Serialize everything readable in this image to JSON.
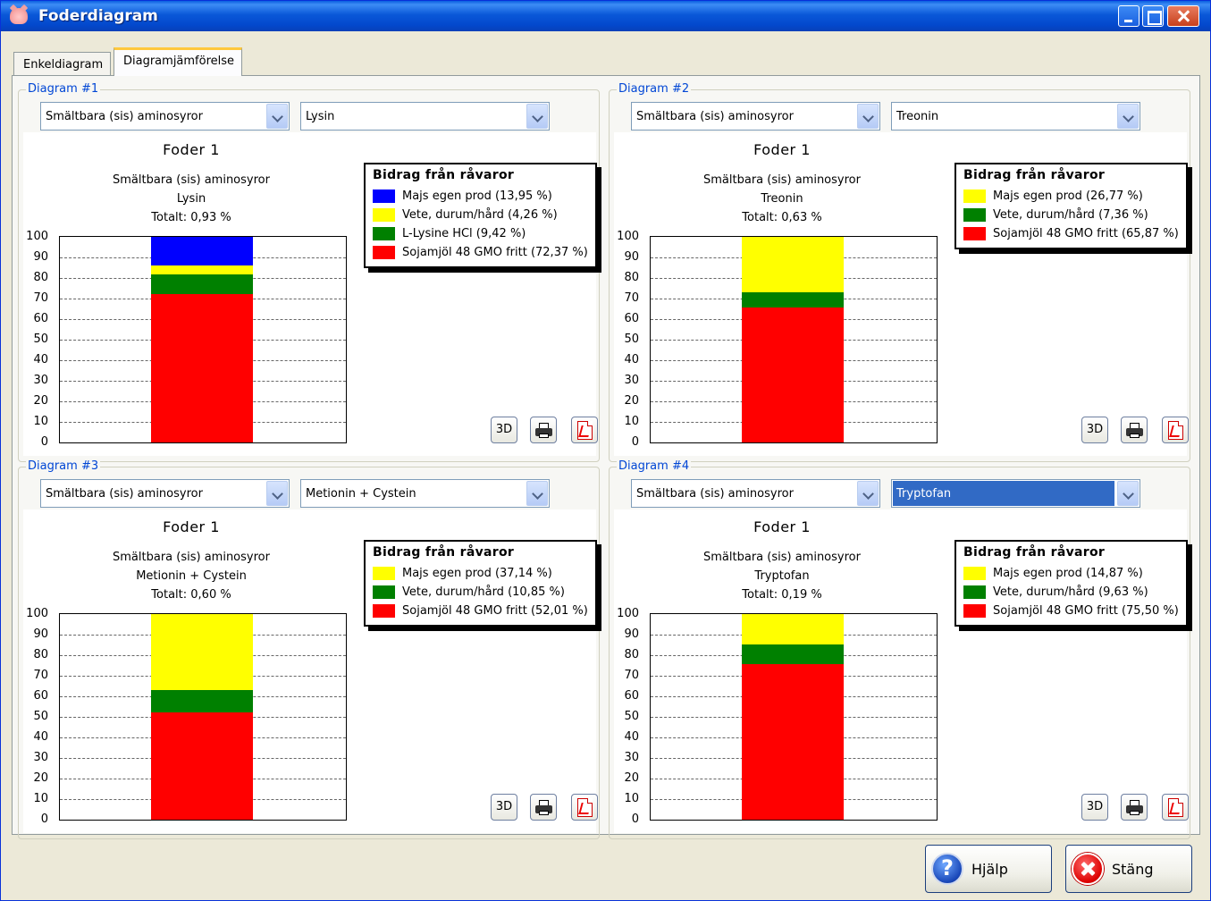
{
  "window": {
    "title": "Foderdiagram"
  },
  "tabs": [
    {
      "label": "Enkeldiagram",
      "active": false
    },
    {
      "label": "Diagramjämförelse",
      "active": true
    }
  ],
  "colors": {
    "yellow": "#ffff00",
    "green": "#008000",
    "red": "#ff0000",
    "blue": "#0000ff",
    "group_title": "#0046d5"
  },
  "icons": {
    "print": "printer-icon",
    "pdf": "pdf-icon",
    "help": "help-icon",
    "close": "close-icon"
  },
  "diagrams": [
    {
      "title": "Diagram #1",
      "category": "Smältbara (sis) aminosyror",
      "nutrient": "Lysin",
      "nutrient_selected": false,
      "feed": "Foder 1",
      "line1": "Smältbara (sis) aminosyror",
      "line2": "Lysin",
      "total": "Totalt: 0,93 %",
      "legend_title": "Bidrag från råvaror",
      "legend": [
        {
          "label": "Majs egen prod (13,95 %)",
          "color": "#0000ff"
        },
        {
          "label": "Vete, durum/hård (4,26 %)",
          "color": "#ffff00"
        },
        {
          "label": "L-Lysine HCl (9,42 %)",
          "color": "#008000"
        },
        {
          "label": "Sojamjöl 48 GMO fritt (72,37 %)",
          "color": "#ff0000"
        }
      ],
      "btn_3d": "3D"
    },
    {
      "title": "Diagram #2",
      "category": "Smältbara (sis) aminosyror",
      "nutrient": "Treonin",
      "nutrient_selected": false,
      "feed": "Foder 1",
      "line1": "Smältbara (sis) aminosyror",
      "line2": "Treonin",
      "total": "Totalt: 0,63 %",
      "legend_title": "Bidrag från råvaror",
      "legend": [
        {
          "label": "Majs egen prod (26,77 %)",
          "color": "#ffff00"
        },
        {
          "label": "Vete, durum/hård (7,36 %)",
          "color": "#008000"
        },
        {
          "label": "Sojamjöl 48 GMO fritt (65,87 %)",
          "color": "#ff0000"
        }
      ],
      "btn_3d": "3D"
    },
    {
      "title": "Diagram #3",
      "category": "Smältbara (sis) aminosyror",
      "nutrient": "Metionin + Cystein",
      "nutrient_selected": false,
      "feed": "Foder 1",
      "line1": "Smältbara (sis) aminosyror",
      "line2": "Metionin + Cystein",
      "total": "Totalt: 0,60 %",
      "legend_title": "Bidrag från råvaror",
      "legend": [
        {
          "label": "Majs egen prod (37,14 %)",
          "color": "#ffff00"
        },
        {
          "label": "Vete, durum/hård (10,85 %)",
          "color": "#008000"
        },
        {
          "label": "Sojamjöl 48 GMO fritt (52,01 %)",
          "color": "#ff0000"
        }
      ],
      "btn_3d": "3D"
    },
    {
      "title": "Diagram #4",
      "category": "Smältbara (sis) aminosyror",
      "nutrient": "Tryptofan",
      "nutrient_selected": true,
      "feed": "Foder 1",
      "line1": "Smältbara (sis) aminosyror",
      "line2": "Tryptofan",
      "total": "Totalt: 0,19 %",
      "legend_title": "Bidrag från råvaror",
      "legend": [
        {
          "label": "Majs egen prod (14,87 %)",
          "color": "#ffff00"
        },
        {
          "label": "Vete, durum/hård (9,63 %)",
          "color": "#008000"
        },
        {
          "label": "Sojamjöl 48 GMO fritt (75,50 %)",
          "color": "#ff0000"
        }
      ],
      "btn_3d": "3D"
    }
  ],
  "chart_data": [
    {
      "type": "bar",
      "stacked": true,
      "categories": [
        "Foder 1"
      ],
      "title": "Foder 1",
      "subtitle": "Smältbara (sis) aminosyror / Lysin / Totalt: 0,93 %",
      "ylim": [
        0,
        100
      ],
      "yticks": [
        0,
        10,
        20,
        30,
        40,
        50,
        60,
        70,
        80,
        90,
        100
      ],
      "grid": true,
      "legend_position": "top-right",
      "series": [
        {
          "name": "Sojamjöl 48 GMO fritt (72,37 %)",
          "values": [
            72.37
          ],
          "color": "#ff0000"
        },
        {
          "name": "L-Lysine HCl (9,42 %)",
          "values": [
            9.42
          ],
          "color": "#008000"
        },
        {
          "name": "Vete, durum/hård (4,26 %)",
          "values": [
            4.26
          ],
          "color": "#ffff00"
        },
        {
          "name": "Majs egen prod (13,95 %)",
          "values": [
            13.95
          ],
          "color": "#0000ff"
        }
      ]
    },
    {
      "type": "bar",
      "stacked": true,
      "categories": [
        "Foder 1"
      ],
      "title": "Foder 1",
      "subtitle": "Smältbara (sis) aminosyror / Treonin / Totalt: 0,63 %",
      "ylim": [
        0,
        100
      ],
      "yticks": [
        0,
        10,
        20,
        30,
        40,
        50,
        60,
        70,
        80,
        90,
        100
      ],
      "grid": true,
      "legend_position": "top-right",
      "series": [
        {
          "name": "Sojamjöl 48 GMO fritt (65,87 %)",
          "values": [
            65.87
          ],
          "color": "#ff0000"
        },
        {
          "name": "Vete, durum/hård (7,36 %)",
          "values": [
            7.36
          ],
          "color": "#008000"
        },
        {
          "name": "Majs egen prod (26,77 %)",
          "values": [
            26.77
          ],
          "color": "#ffff00"
        }
      ]
    },
    {
      "type": "bar",
      "stacked": true,
      "categories": [
        "Foder 1"
      ],
      "title": "Foder 1",
      "subtitle": "Smältbara (sis) aminosyror / Metionin + Cystein / Totalt: 0,60 %",
      "ylim": [
        0,
        100
      ],
      "yticks": [
        0,
        10,
        20,
        30,
        40,
        50,
        60,
        70,
        80,
        90,
        100
      ],
      "grid": true,
      "legend_position": "top-right",
      "series": [
        {
          "name": "Sojamjöl 48 GMO fritt (52,01 %)",
          "values": [
            52.01
          ],
          "color": "#ff0000"
        },
        {
          "name": "Vete, durum/hård (10,85 %)",
          "values": [
            10.85
          ],
          "color": "#008000"
        },
        {
          "name": "Majs egen prod (37,14 %)",
          "values": [
            37.14
          ],
          "color": "#ffff00"
        }
      ]
    },
    {
      "type": "bar",
      "stacked": true,
      "categories": [
        "Foder 1"
      ],
      "title": "Foder 1",
      "subtitle": "Smältbara (sis) aminosyror / Tryptofan / Totalt: 0,19 %",
      "ylim": [
        0,
        100
      ],
      "yticks": [
        0,
        10,
        20,
        30,
        40,
        50,
        60,
        70,
        80,
        90,
        100
      ],
      "grid": true,
      "legend_position": "top-right",
      "series": [
        {
          "name": "Sojamjöl 48 GMO fritt (75,50 %)",
          "values": [
            75.5
          ],
          "color": "#ff0000"
        },
        {
          "name": "Vete, durum/hård (9,63 %)",
          "values": [
            9.63
          ],
          "color": "#008000"
        },
        {
          "name": "Majs egen prod (14,87 %)",
          "values": [
            14.87
          ],
          "color": "#ffff00"
        }
      ]
    }
  ],
  "buttons": {
    "help": "Hjälp",
    "close": "Stäng"
  }
}
